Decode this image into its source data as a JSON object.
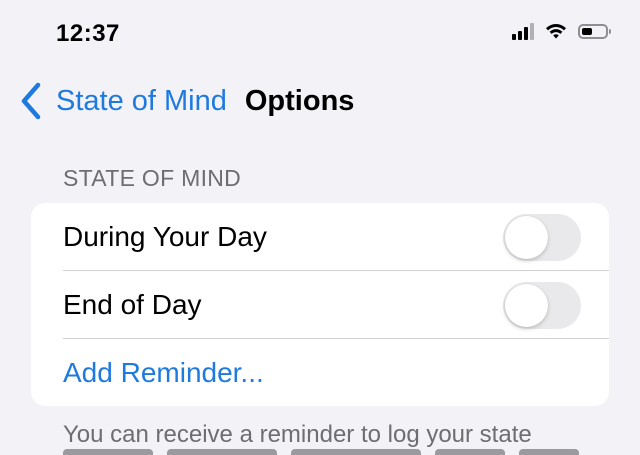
{
  "status_bar": {
    "time": "12:37",
    "battery_level": 0.45
  },
  "nav": {
    "back_label": "State of Mind",
    "title": "Options"
  },
  "section": {
    "header": "STATE OF MIND",
    "rows": [
      {
        "label": "During Your Day",
        "toggle_on": false
      },
      {
        "label": "End of Day",
        "toggle_on": false
      }
    ],
    "add_reminder": "Add Reminder..."
  },
  "footer": {
    "note": "You can receive a reminder to log your state"
  },
  "colors": {
    "accent": "#1f7ae0",
    "background": "#f2f2f7",
    "toggle_off": "#e9e9eb"
  }
}
